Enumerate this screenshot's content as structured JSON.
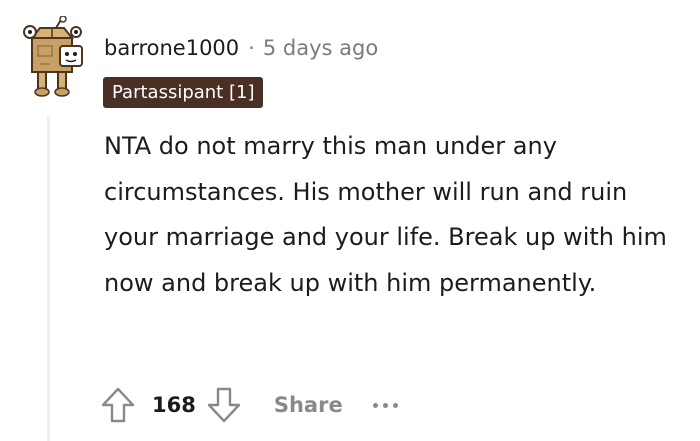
{
  "comment": {
    "username": "barrone1000",
    "separator": "·",
    "timestamp": "5 days ago",
    "flair": "Partassipant [1]",
    "body": "NTA do not marry this man under any circumstances. His mother will run and ruin your marriage and your life. Break up with him now and break up with him permanently.",
    "avatar_icon": "snoo-box-avatar-icon"
  },
  "actions": {
    "upvote_icon": "upvote-arrow-icon",
    "score": "168",
    "downvote_icon": "downvote-arrow-icon",
    "share_label": "Share",
    "more_icon": "more-options-icon"
  },
  "colors": {
    "flair_background": "#4a2f24",
    "muted_text": "#7c7c7c",
    "action_gray": "#878a8c",
    "thread_line": "#edeff1"
  }
}
